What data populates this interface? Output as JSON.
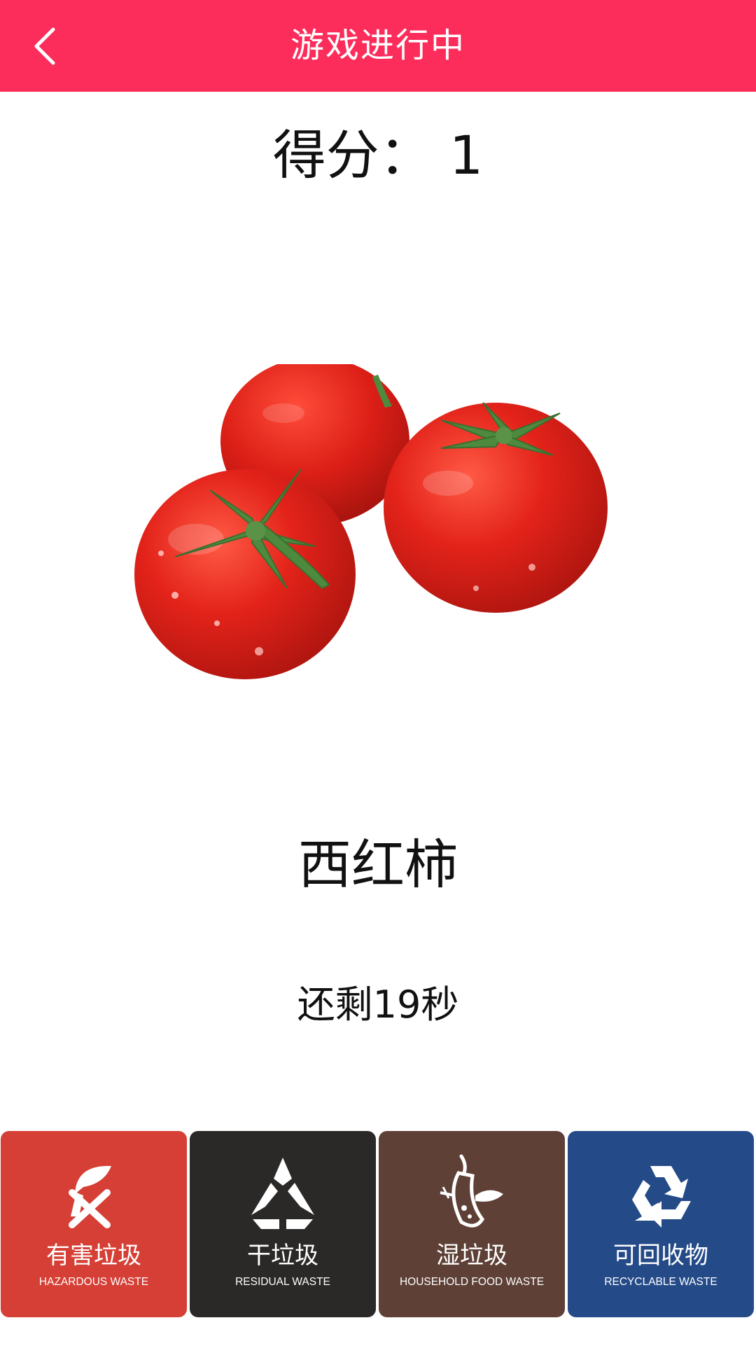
{
  "header": {
    "title": "游戏进行中",
    "back_icon": "chevron-left-icon"
  },
  "score": {
    "label": "得分：",
    "value": "1",
    "text": "得分：  1"
  },
  "item": {
    "image": "tomato-photo",
    "name": "西红柿"
  },
  "timer": {
    "text": "还剩19秒"
  },
  "bins": [
    {
      "cn": "有害垃圾",
      "en": "HAZARDOUS WASTE",
      "icon": "hazardous-waste-icon",
      "color": "#d53f35"
    },
    {
      "cn": "干垃圾",
      "en": "RESIDUAL WASTE",
      "icon": "residual-waste-icon",
      "color": "#2a2927"
    },
    {
      "cn": "湿垃圾",
      "en": "HOUSEHOLD FOOD WASTE",
      "icon": "food-waste-icon",
      "color": "#5e4036"
    },
    {
      "cn": "可回收物",
      "en": "RECYCLABLE WASTE",
      "icon": "recycle-icon",
      "color": "#244b88"
    }
  ],
  "colors": {
    "header_bg": "#fc2c5b",
    "text": "#111111",
    "tomato_red": "#e0241b",
    "stem_green": "#4d8a3e"
  }
}
